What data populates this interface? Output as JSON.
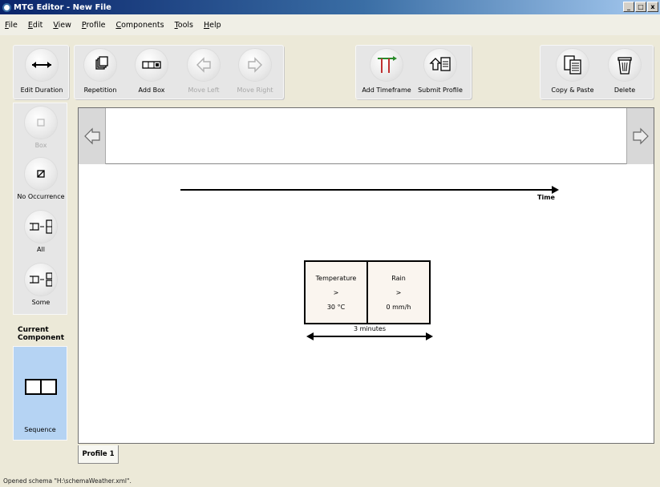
{
  "window": {
    "title": "MTG Editor - New File",
    "controls": [
      "_",
      "□",
      "x"
    ]
  },
  "menu": [
    "File",
    "Edit",
    "View",
    "Profile",
    "Components",
    "Tools",
    "Help"
  ],
  "toolbar": {
    "edit_duration": "Edit Duration",
    "repetition": "Repetition",
    "add_box": "Add Box",
    "move_left": "Move Left",
    "move_right": "Move Right",
    "add_timeframe": "Add Timeframe",
    "submit_profile": "Submit Profile",
    "copy_paste": "Copy & Paste",
    "delete": "Delete"
  },
  "components": {
    "box": "Box",
    "no_occurrence": "No Occurrence",
    "all": "All",
    "some": "Some"
  },
  "current_component": {
    "title_line1": "Current",
    "title_line2": "Component",
    "name": "Sequence"
  },
  "canvas": {
    "time_label": "Time",
    "boxes": [
      {
        "name": "Temperature",
        "op": ">",
        "value": "30 °C"
      },
      {
        "name": "Rain",
        "op": ">",
        "value": "0 mm/h"
      }
    ],
    "duration": "3 minutes"
  },
  "tabs": [
    "Profile 1"
  ],
  "status": "Opened schema \"H:\\schemaWeather.xml\".",
  "colors": {
    "current_component_bg": "#b5d3f3",
    "titlebar": "#0a246a",
    "box_fill": "#faf5ef"
  }
}
